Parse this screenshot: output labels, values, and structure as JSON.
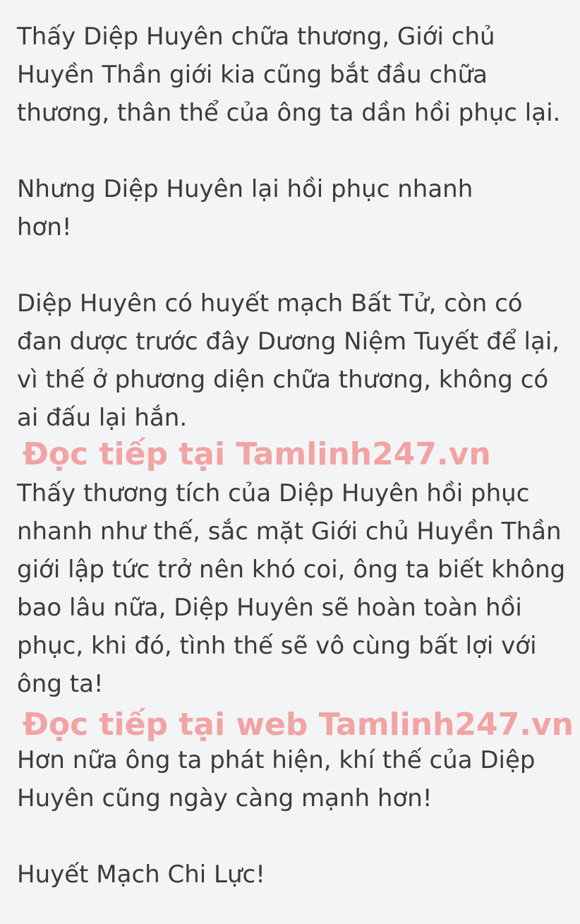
{
  "paragraphs": [
    "      Thấy Diệp Huyên chữa thương, Giới chủ\nHuyền Thần giới kia cũng bắt đầu chữa\nthương, thân thể của ông ta dần hồi phục lại.",
    "      Nhưng Diệp Huyên lại hồi phục nhanh\nhơn!",
    "      Diệp Huyên có huyết mạch Bất Tử, còn có\nđan dược trước đây Dương Niệm Tuyết để lại,\nvì thế ở phương diện chữa thương, không có\nai đấu lại hắn.",
    "      Thấy thương tích của Diệp Huyên hồi phục\nnhanh như thế, sắc mặt Giới chủ Huyền Thần\ngiới lập tức trở nên khó coi, ông ta biết không\nbao lâu nữa, Diệp Huyên sẽ hoàn toàn hồi\nphục, khi đó, tình thế sẽ vô cùng bất lợi với\nông ta!",
    "      Hơn nữa ông ta phát hiện, khí thế của Diệp\nHuyên cũng ngày càng mạnh hơn!",
    "      Huyết Mạch Chi Lực!"
  ],
  "watermarks": [
    "Đọc tiếp tại Tamlinh247.vn",
    "Đọc tiếp tại web Tamlinh247.vn"
  ],
  "colors": {
    "background": "#f3f4f6",
    "text": "#3b3b3f",
    "watermark": "#f2a3a3"
  }
}
